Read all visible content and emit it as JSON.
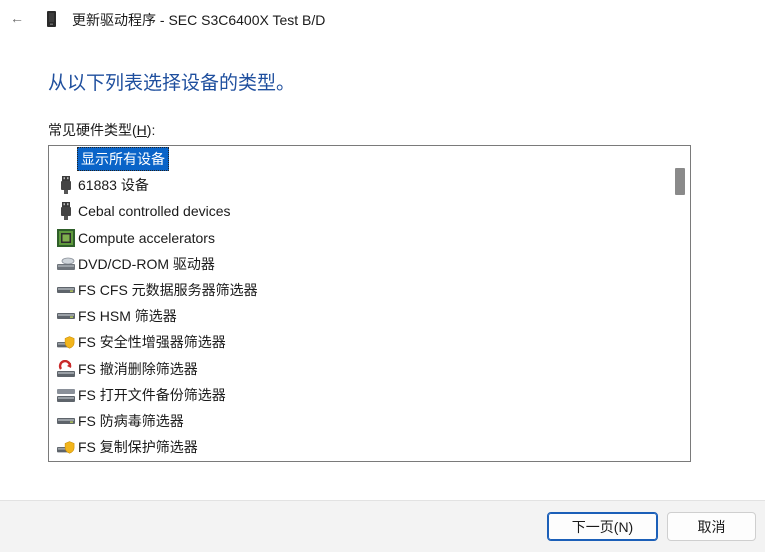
{
  "window": {
    "title": "更新驱动程序 - SEC S3C6400X Test B/D",
    "back_glyph": "←"
  },
  "main": {
    "heading": "从以下列表选择设备的类型。",
    "list_label_prefix": "常见硬件类型(",
    "list_label_accel": "H",
    "list_label_suffix": "):"
  },
  "list": {
    "items": [
      {
        "label": "显示所有设备",
        "icon": "none",
        "selected": true
      },
      {
        "label": "61883 设备",
        "icon": "usb-plug-icon"
      },
      {
        "label": "Cebal controlled devices",
        "icon": "usb-plug-icon"
      },
      {
        "label": "Compute accelerators",
        "icon": "chip-icon"
      },
      {
        "label": "DVD/CD-ROM 驱动器",
        "icon": "optical-drive-icon"
      },
      {
        "label": "FS CFS 元数据服务器筛选器",
        "icon": "disk-drive-icon"
      },
      {
        "label": "FS HSM 筛选器",
        "icon": "disk-drive-icon"
      },
      {
        "label": "FS 安全性增强器筛选器",
        "icon": "secure-drive-icon"
      },
      {
        "label": "FS 撤消删除筛选器",
        "icon": "undelete-drive-icon"
      },
      {
        "label": "FS 打开文件备份筛选器",
        "icon": "backup-drive-icon"
      },
      {
        "label": "FS 防病毒筛选器",
        "icon": "disk-drive-icon"
      },
      {
        "label": "FS 复制保护筛选器",
        "icon": "secure-drive-icon"
      }
    ]
  },
  "footer": {
    "next_label": "下一页(N)",
    "cancel_label": "取消"
  },
  "colors": {
    "heading": "#1f4f9e",
    "selection": "#0a64c8",
    "primary_border": "#1b5fb8"
  }
}
